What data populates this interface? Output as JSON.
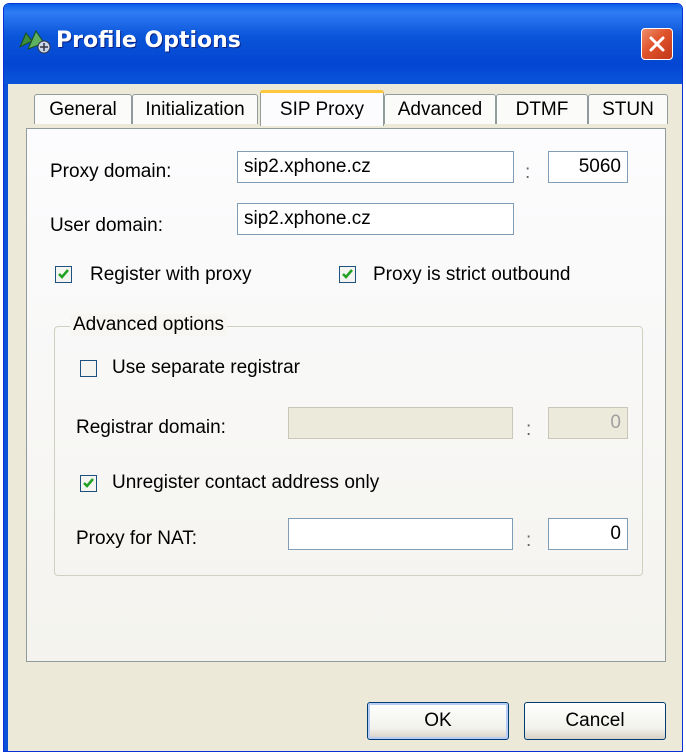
{
  "window": {
    "title": "Profile Options",
    "icon": "network-phone-icon",
    "close_icon": "close-icon"
  },
  "tabs": [
    {
      "label": "General",
      "active": false
    },
    {
      "label": "Initialization",
      "active": false
    },
    {
      "label": "SIP Proxy",
      "active": true
    },
    {
      "label": "Advanced",
      "active": false
    },
    {
      "label": "DTMF",
      "active": false
    },
    {
      "label": "STUN",
      "active": false
    }
  ],
  "sip_proxy": {
    "proxy_domain_label": "Proxy domain:",
    "proxy_domain_value": "sip2.xphone.cz",
    "proxy_port_value": "5060",
    "user_domain_label": "User domain:",
    "user_domain_value": "sip2.xphone.cz",
    "register_with_proxy_label": "Register with proxy",
    "register_with_proxy_checked": true,
    "strict_outbound_label": "Proxy is strict outbound",
    "strict_outbound_checked": true,
    "colon": ":"
  },
  "advanced_options": {
    "legend": "Advanced options",
    "separate_registrar_label": "Use separate registrar",
    "separate_registrar_checked": false,
    "registrar_domain_label": "Registrar domain:",
    "registrar_domain_value": "",
    "registrar_port_value": "0",
    "unregister_label": "Unregister contact address only",
    "unregister_checked": true,
    "proxy_nat_label": "Proxy for NAT:",
    "proxy_nat_value": "",
    "proxy_nat_port_value": "0"
  },
  "buttons": {
    "ok": "OK",
    "cancel": "Cancel"
  },
  "colors": {
    "titlebar": "#0a55d9",
    "dialog_bg": "#ece9d8",
    "active_tab_accent": "#ffc83c",
    "checkmark": "#21a121"
  }
}
